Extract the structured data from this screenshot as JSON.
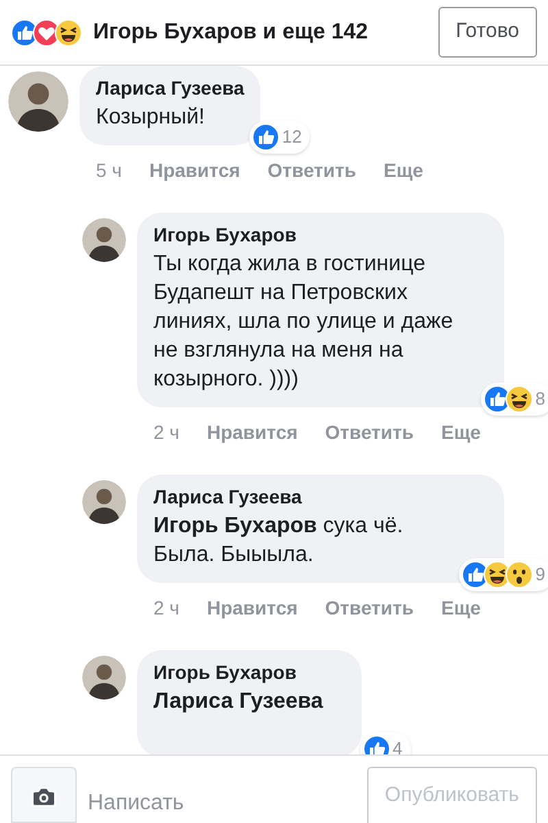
{
  "header": {
    "reactions": [
      {
        "kind": "like"
      },
      {
        "kind": "love"
      },
      {
        "kind": "haha"
      }
    ],
    "title": "Игорь Бухаров и еще 142",
    "done_button": "Готово"
  },
  "comments": [
    {
      "author": "Лариса Гузеева",
      "text": "Козырный!",
      "reactions": [
        {
          "kind": "like"
        }
      ],
      "count": "12",
      "time": "5 ч",
      "actions": [
        "Нравится",
        "Ответить",
        "Еще"
      ],
      "replies": [
        {
          "author": "Игорь Бухаров",
          "text": "Ты когда жила в гостинице Будапешт на Петровских линиях, шла по улице и даже не взглянула на меня на козырного. ))))",
          "reactions": [
            {
              "kind": "like"
            },
            {
              "kind": "haha"
            }
          ],
          "count": "8",
          "time": "2 ч",
          "actions": [
            "Нравится",
            "Ответить",
            "Еще"
          ]
        },
        {
          "author": "Лариса Гузеева",
          "mention": "Игорь Бухаров",
          "text": "сука чё. Была. Быыыла.",
          "reactions": [
            {
              "kind": "like"
            },
            {
              "kind": "haha"
            },
            {
              "kind": "wow"
            }
          ],
          "count": "9",
          "time": "2 ч",
          "actions": [
            "Нравится",
            "Ответить",
            "Еще"
          ]
        },
        {
          "author": "Игорь Бухаров",
          "mention": "Лариса Гузеева",
          "reactions": [
            {
              "kind": "like"
            }
          ],
          "count": "4"
        }
      ]
    }
  ],
  "composer": {
    "placeholder": "Написать",
    "publish_button": "Опубликовать"
  }
}
